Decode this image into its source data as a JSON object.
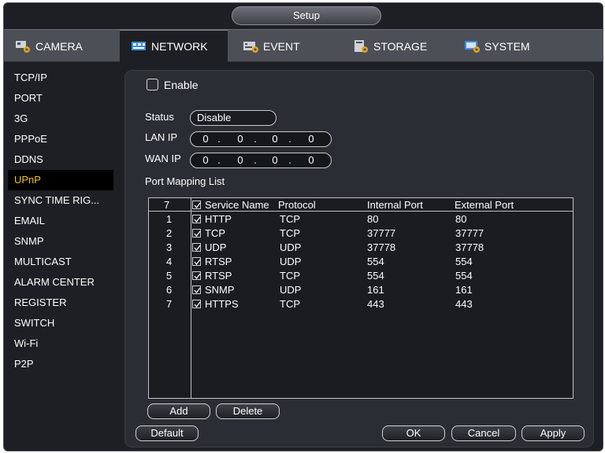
{
  "window": {
    "title": "Setup"
  },
  "tabs": [
    {
      "label": "CAMERA",
      "icon": "camera-gear-icon"
    },
    {
      "label": "NETWORK",
      "icon": "network-icon"
    },
    {
      "label": "EVENT",
      "icon": "event-icon"
    },
    {
      "label": "STORAGE",
      "icon": "storage-icon"
    },
    {
      "label": "SYSTEM",
      "icon": "system-icon"
    }
  ],
  "active_tab": "NETWORK",
  "sidebar": {
    "items": [
      "TCP/IP",
      "PORT",
      "3G",
      "PPPoE",
      "DDNS",
      "UPnP",
      "SYNC TIME RIG...",
      "EMAIL",
      "SNMP",
      "MULTICAST",
      "ALARM CENTER",
      "REGISTER",
      "SWITCH",
      "Wi-Fi",
      "P2P"
    ],
    "active": "UPnP"
  },
  "form": {
    "enable_label": "Enable",
    "status_label": "Status",
    "status_value": "Disable",
    "lan_ip_label": "LAN IP",
    "lan_ip": [
      "0",
      "0",
      "0",
      "0"
    ],
    "wan_ip_label": "WAN IP",
    "wan_ip": [
      "0",
      "0",
      "0",
      "0"
    ],
    "port_mapping_label": "Port Mapping List"
  },
  "table": {
    "count": "7",
    "headers": [
      "Service Name",
      "Protocol",
      "Internal Port",
      "External Port"
    ],
    "rows": [
      {
        "idx": "1",
        "service": "HTTP",
        "protocol": "TCP",
        "internal": "80",
        "external": "80"
      },
      {
        "idx": "2",
        "service": "TCP",
        "protocol": "TCP",
        "internal": "37777",
        "external": "37777"
      },
      {
        "idx": "3",
        "service": "UDP",
        "protocol": "UDP",
        "internal": "37778",
        "external": "37778"
      },
      {
        "idx": "4",
        "service": "RTSP",
        "protocol": "UDP",
        "internal": "554",
        "external": "554"
      },
      {
        "idx": "5",
        "service": "RTSP",
        "protocol": "TCP",
        "internal": "554",
        "external": "554"
      },
      {
        "idx": "6",
        "service": "SNMP",
        "protocol": "UDP",
        "internal": "161",
        "external": "161"
      },
      {
        "idx": "7",
        "service": "HTTPS",
        "protocol": "TCP",
        "internal": "443",
        "external": "443"
      }
    ]
  },
  "buttons": {
    "add": "Add",
    "delete": "Delete",
    "default": "Default",
    "ok": "OK",
    "cancel": "Cancel",
    "apply": "Apply"
  },
  "colors": {
    "active_sidebar_text": "#f3c11b",
    "background": "#1e1f24",
    "panel": "#2b2d34"
  }
}
